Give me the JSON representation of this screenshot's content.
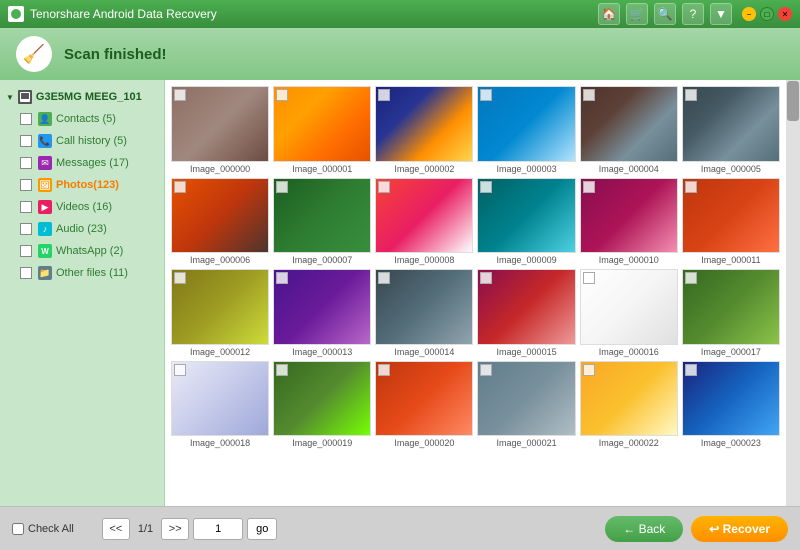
{
  "titlebar": {
    "title": "Tenorshare Android Data Recovery",
    "home_icon": "🏠",
    "cart_icon": "🛒",
    "search_icon": "🔍",
    "help_icon": "?",
    "menu_icon": "▼",
    "min_icon": "−",
    "max_icon": "□",
    "close_icon": "✕"
  },
  "statusbar": {
    "icon": "🧹",
    "text": "Scan finished!"
  },
  "sidebar": {
    "device_name": "G3E5MG MEEG_101",
    "items": [
      {
        "id": "contacts",
        "label": "Contacts (5)",
        "icon": "👤",
        "icon_class": "icon-contacts"
      },
      {
        "id": "callhistory",
        "label": "Call history (5)",
        "icon": "📞",
        "icon_class": "icon-calls"
      },
      {
        "id": "messages",
        "label": "Messages (17)",
        "icon": "✉",
        "icon_class": "icon-messages"
      },
      {
        "id": "photos",
        "label": "Photos(123)",
        "icon": "🖼",
        "icon_class": "icon-photos",
        "active": true
      },
      {
        "id": "videos",
        "label": "Videos (16)",
        "icon": "▶",
        "icon_class": "icon-videos"
      },
      {
        "id": "audio",
        "label": "Audio (23)",
        "icon": "🎵",
        "icon_class": "icon-audio"
      },
      {
        "id": "whatsapp",
        "label": "WhatsApp (2)",
        "icon": "W",
        "icon_class": "icon-whatsapp"
      },
      {
        "id": "otherfiles",
        "label": "Other files (11)",
        "icon": "📁",
        "icon_class": "icon-files"
      }
    ]
  },
  "photos": {
    "items": [
      "Image_000000",
      "Image_000001",
      "Image_000002",
      "Image_000003",
      "Image_000004",
      "Image_000005",
      "Image_000006",
      "Image_000007",
      "Image_000008",
      "Image_000009",
      "Image_000010",
      "Image_000011",
      "Image_000012",
      "Image_000013",
      "Image_000014",
      "Image_000015",
      "Image_000016",
      "Image_000017",
      "Image_000018",
      "Image_000019",
      "Image_000020",
      "Image_000021",
      "Image_000022",
      "Image_000023"
    ],
    "thumb_classes": [
      "t0",
      "t1",
      "t2",
      "t3",
      "t4",
      "t5",
      "t6",
      "t7",
      "t8",
      "t9",
      "t10",
      "t11",
      "t12",
      "t13",
      "t14",
      "t15",
      "t16",
      "t17",
      "t18",
      "t19",
      "t20",
      "t21",
      "t22",
      "t23"
    ]
  },
  "bottombar": {
    "check_all_label": "Check All",
    "prev_btn": "<<",
    "page_info": "1/1",
    "next_btn": ">>",
    "page_input_value": "1",
    "go_btn": "go",
    "back_btn": "← Back",
    "recover_btn": "↩ Recover"
  }
}
